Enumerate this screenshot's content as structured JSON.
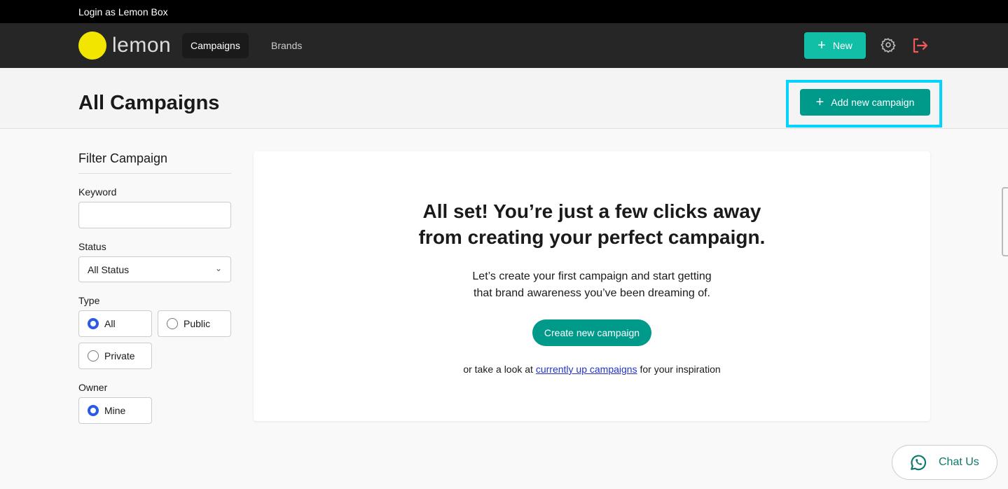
{
  "topbar": {
    "login_text": "Login as Lemon Box"
  },
  "nav": {
    "logo_text": "lemon",
    "items": [
      {
        "label": "Campaigns",
        "active": true
      },
      {
        "label": "Brands",
        "active": false
      }
    ],
    "new_label": "New",
    "icons": [
      "plus-icon",
      "gear-icon",
      "logout-icon"
    ]
  },
  "header": {
    "title": "All Campaigns",
    "add_label": "Add new campaign"
  },
  "filter": {
    "title": "Filter Campaign",
    "keyword_label": "Keyword",
    "keyword_value": "",
    "status_label": "Status",
    "status_value": "All Status",
    "type_label": "Type",
    "type_options": [
      {
        "label": "All",
        "checked": true
      },
      {
        "label": "Public",
        "checked": false
      },
      {
        "label": "Private",
        "checked": false
      }
    ],
    "owner_label": "Owner",
    "owner_options": [
      {
        "label": "Mine",
        "checked": true
      }
    ]
  },
  "empty": {
    "heading_line1": "All set! You’re just a few clicks away",
    "heading_line2": "from creating your perfect campaign.",
    "sub_line1": "Let’s create your first campaign and start getting",
    "sub_line2": "that brand awareness you’ve been dreaming of.",
    "button": "Create new campaign",
    "ins_before": "or take a look at ",
    "ins_link": "currently up campaigns",
    "ins_after": " for your inspiration"
  },
  "chat": {
    "label": "Chat Us"
  },
  "colors": {
    "accent": "#009a8a",
    "new_button": "#10bfa6",
    "logo": "#f2e600",
    "highlight": "#00d4ff",
    "logout": "#f05a5a"
  }
}
